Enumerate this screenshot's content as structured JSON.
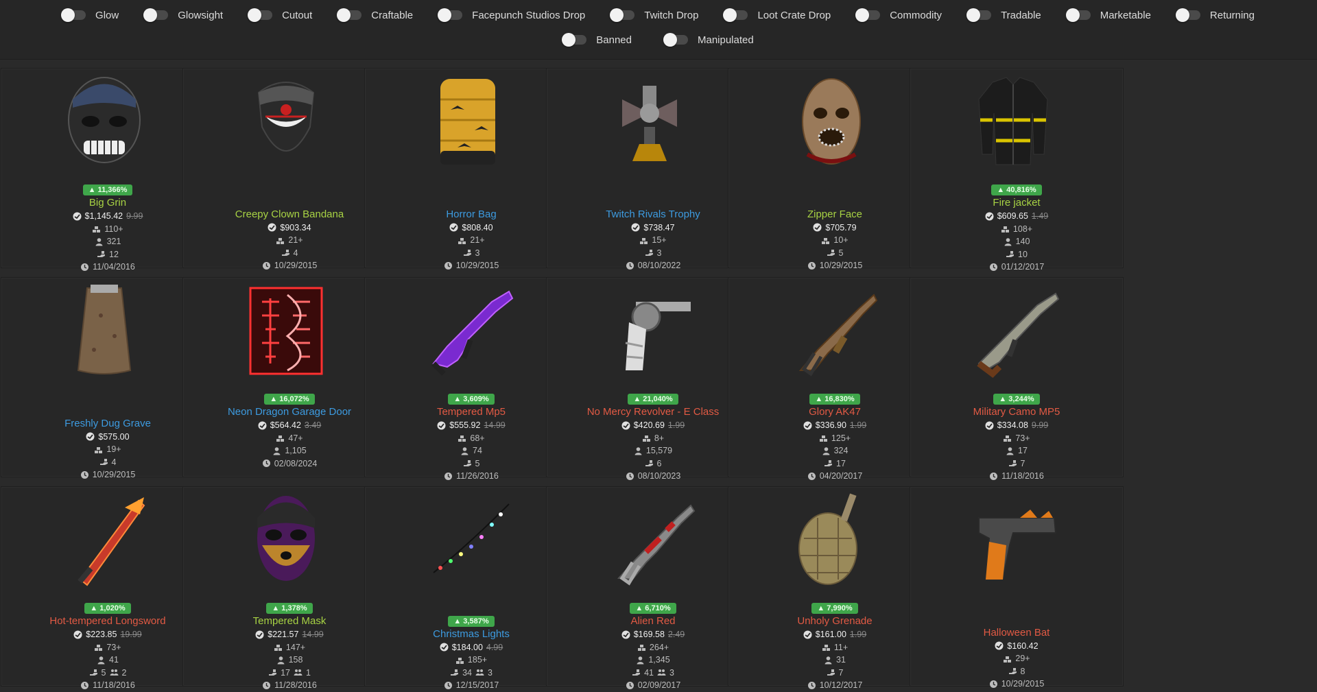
{
  "filters": {
    "row1": [
      "Glow",
      "Glowsight",
      "Cutout",
      "Craftable",
      "Facepunch Studios Drop",
      "Twitch Drop",
      "Loot Crate Drop",
      "Commodity",
      "Tradable",
      "Marketable",
      "Returning"
    ],
    "row2": [
      "Banned",
      "Manipulated"
    ]
  },
  "colors": {
    "blue": "#3d9be0",
    "lime": "#a8d344",
    "red": "#e25a44",
    "badge": "#3fa64a"
  },
  "items": [
    {
      "name": "Big Grin",
      "color": "lime",
      "badge": "▲ 11,366%",
      "price": "$1,145.42",
      "old": "9.99",
      "listings": "110+",
      "owners": "321",
      "stat": "12",
      "stat2": "",
      "date": "11/04/2016",
      "icon": "mask-skull-icon"
    },
    {
      "name": "Creepy Clown Bandana",
      "color": "lime",
      "badge": "",
      "price": "$903.34",
      "old": "",
      "listings": "21+",
      "owners": "",
      "stat": "4",
      "stat2": "",
      "date": "10/29/2015",
      "icon": "clown-bandana-icon"
    },
    {
      "name": "Horror Bag",
      "color": "blue",
      "badge": "",
      "price": "$808.40",
      "old": "",
      "listings": "21+",
      "owners": "",
      "stat": "3",
      "stat2": "",
      "date": "10/29/2015",
      "icon": "sleeping-bag-icon"
    },
    {
      "name": "Twitch Rivals Trophy",
      "color": "blue",
      "badge": "",
      "price": "$738.47",
      "old": "",
      "listings": "15+",
      "owners": "",
      "stat": "3",
      "stat2": "",
      "date": "08/10/2022",
      "icon": "trophy-icon"
    },
    {
      "name": "Zipper Face",
      "color": "lime",
      "badge": "",
      "price": "$705.79",
      "old": "",
      "listings": "10+",
      "owners": "",
      "stat": "5",
      "stat2": "",
      "date": "10/29/2015",
      "icon": "zipper-mask-icon"
    },
    {
      "name": "Fire jacket",
      "color": "lime",
      "badge": "▲ 40,816%",
      "price": "$609.65",
      "old": "1.49",
      "listings": "108+",
      "owners": "140",
      "stat": "10",
      "stat2": "",
      "date": "01/12/2017",
      "icon": "jacket-icon"
    },
    {
      "name": "Freshly Dug Grave",
      "color": "blue",
      "badge": "",
      "price": "$575.00",
      "old": "",
      "listings": "19+",
      "owners": "",
      "stat": "4",
      "stat2": "",
      "date": "10/29/2015",
      "icon": "grave-bag-icon"
    },
    {
      "name": "Neon Dragon Garage Door",
      "color": "blue",
      "badge": "▲ 16,072%",
      "price": "$564.42",
      "old": "3.49",
      "listings": "47+",
      "owners": "1,105",
      "stat": "",
      "stat2": "",
      "date": "02/08/2024",
      "icon": "neon-door-icon"
    },
    {
      "name": "Tempered Mp5",
      "color": "red",
      "badge": "▲ 3,609%",
      "price": "$555.92",
      "old": "14.99",
      "listings": "68+",
      "owners": "74",
      "stat": "5",
      "stat2": "",
      "date": "11/26/2016",
      "icon": "smg-purple-icon"
    },
    {
      "name": "No Mercy Revolver - E Class",
      "color": "red",
      "badge": "▲ 21,040%",
      "price": "$420.69",
      "old": "1.99",
      "listings": "8+",
      "owners": "15,579",
      "stat": "6",
      "stat2": "",
      "date": "08/10/2023",
      "icon": "revolver-icon"
    },
    {
      "name": "Glory AK47",
      "color": "red",
      "badge": "▲ 16,830%",
      "price": "$336.90",
      "old": "1.99",
      "listings": "125+",
      "owners": "324",
      "stat": "17",
      "stat2": "",
      "date": "04/20/2017",
      "icon": "rifle-glory-icon"
    },
    {
      "name": "Military Camo MP5",
      "color": "red",
      "badge": "▲ 3,244%",
      "price": "$334.08",
      "old": "9.99",
      "listings": "73+",
      "owners": "17",
      "stat": "7",
      "stat2": "",
      "date": "11/18/2016",
      "icon": "smg-camo-icon"
    },
    {
      "name": "Hot-tempered Longsword",
      "color": "red",
      "badge": "▲ 1,020%",
      "price": "$223.85",
      "old": "19.99",
      "listings": "73+",
      "owners": "41",
      "stat": "5",
      "stat2": "2",
      "date": "11/18/2016",
      "icon": "sword-icon"
    },
    {
      "name": "Tempered Mask",
      "color": "lime",
      "badge": "▲ 1,378%",
      "price": "$221.57",
      "old": "14.99",
      "listings": "147+",
      "owners": "158",
      "stat": "17",
      "stat2": "1",
      "date": "11/28/2016",
      "icon": "tempered-mask-icon"
    },
    {
      "name": "Christmas Lights",
      "color": "blue",
      "badge": "▲ 3,587%",
      "price": "$184.00",
      "old": "4.99",
      "listings": "185+",
      "owners": "",
      "stat": "34",
      "stat2": "3",
      "date": "12/15/2017",
      "icon": "lights-icon"
    },
    {
      "name": "Alien Red",
      "color": "red",
      "badge": "▲ 6,710%",
      "price": "$169.58",
      "old": "2.49",
      "listings": "264+",
      "owners": "1,345",
      "stat": "41",
      "stat2": "3",
      "date": "02/09/2017",
      "icon": "rifle-red-icon"
    },
    {
      "name": "Unholy Grenade",
      "color": "red",
      "badge": "▲ 7,990%",
      "price": "$161.00",
      "old": "1.99",
      "listings": "11+",
      "owners": "31",
      "stat": "7",
      "stat2": "",
      "date": "10/12/2017",
      "icon": "grenade-icon"
    },
    {
      "name": "Halloween Bat",
      "color": "red",
      "badge": "",
      "price": "$160.42",
      "old": "",
      "listings": "29+",
      "owners": "",
      "stat": "8",
      "stat2": "",
      "date": "10/29/2015",
      "icon": "pistol-icon"
    }
  ]
}
